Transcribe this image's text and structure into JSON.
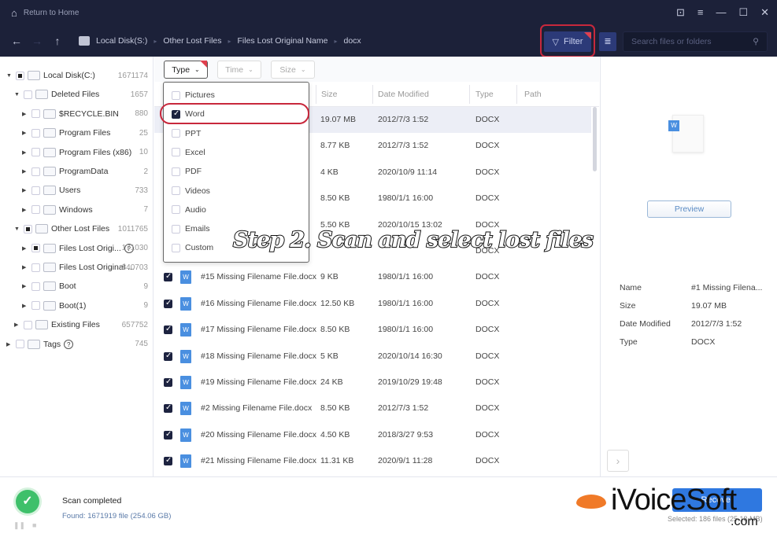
{
  "titlebar": {
    "home_label": "Return to Home"
  },
  "nav": {
    "breadcrumbs": [
      "Local Disk(S:)",
      "Other Lost Files",
      "Files Lost Original Name",
      "docx"
    ],
    "filter_label": "Filter",
    "search_placeholder": "Search files or folders"
  },
  "tree": [
    {
      "label": "Local Disk(C:)",
      "count": "1671174",
      "level": 0,
      "state": "part",
      "open": true
    },
    {
      "label": "Deleted Files",
      "count": "1657",
      "level": 1,
      "state": "none",
      "open": true
    },
    {
      "label": "$RECYCLE.BIN",
      "count": "880",
      "level": 2,
      "state": "none"
    },
    {
      "label": "Program Files",
      "count": "25",
      "level": 2,
      "state": "none"
    },
    {
      "label": "Program Files (x86)",
      "count": "10",
      "level": 2,
      "state": "none"
    },
    {
      "label": "ProgramData",
      "count": "2",
      "level": 2,
      "state": "none"
    },
    {
      "label": "Users",
      "count": "733",
      "level": 2,
      "state": "none"
    },
    {
      "label": "Windows",
      "count": "7",
      "level": 2,
      "state": "none"
    },
    {
      "label": "Other Lost Files",
      "count": "1011765",
      "level": 1,
      "state": "part",
      "open": true
    },
    {
      "label": "Files Lost Origi...",
      "count": "171030",
      "level": 2,
      "state": "part",
      "help": true
    },
    {
      "label": "Files Lost Original ...",
      "count": "840703",
      "level": 2,
      "state": "none"
    },
    {
      "label": "Boot",
      "count": "9",
      "level": 2,
      "state": "none"
    },
    {
      "label": "Boot(1)",
      "count": "9",
      "level": 2,
      "state": "none"
    },
    {
      "label": "Existing Files",
      "count": "657752",
      "level": 1,
      "state": "none"
    },
    {
      "label": "Tags",
      "count": "745",
      "level": 0,
      "state": "none",
      "help": true
    }
  ],
  "filters": {
    "type": "Type",
    "time": "Time",
    "size": "Size"
  },
  "type_options": [
    {
      "label": "Pictures",
      "checked": false
    },
    {
      "label": "Word",
      "checked": true
    },
    {
      "label": "PPT",
      "checked": false
    },
    {
      "label": "Excel",
      "checked": false
    },
    {
      "label": "PDF",
      "checked": false
    },
    {
      "label": "Videos",
      "checked": false
    },
    {
      "label": "Audio",
      "checked": false
    },
    {
      "label": "Emails",
      "checked": false
    },
    {
      "label": "Custom",
      "checked": false
    }
  ],
  "columns": {
    "size": "Size",
    "date": "Date Modified",
    "type": "Type",
    "path": "Path"
  },
  "files": [
    {
      "name": "",
      "size": "19.07 MB",
      "date": "2012/7/3 1:52",
      "type": "DOCX"
    },
    {
      "name": "",
      "size": "8.77 KB",
      "date": "2012/7/3 1:52",
      "type": "DOCX"
    },
    {
      "name": "",
      "size": "4 KB",
      "date": "2020/10/9 11:14",
      "type": "DOCX"
    },
    {
      "name": "",
      "size": "8.50 KB",
      "date": "1980/1/1 16:00",
      "type": "DOCX"
    },
    {
      "name": "",
      "size": "5.50 KB",
      "date": "2020/10/15 13:02",
      "type": "DOCX"
    },
    {
      "name": "",
      "size": "",
      "date": "",
      "type": "DOCX"
    },
    {
      "name": "#15 Missing Filename File.docx",
      "size": "9 KB",
      "date": "1980/1/1 16:00",
      "type": "DOCX"
    },
    {
      "name": "#16 Missing Filename File.docx",
      "size": "12.50 KB",
      "date": "1980/1/1 16:00",
      "type": "DOCX"
    },
    {
      "name": "#17 Missing Filename File.docx",
      "size": "8.50 KB",
      "date": "1980/1/1 16:00",
      "type": "DOCX"
    },
    {
      "name": "#18 Missing Filename File.docx",
      "size": "5 KB",
      "date": "2020/10/14 16:30",
      "type": "DOCX"
    },
    {
      "name": "#19 Missing Filename File.docx",
      "size": "24 KB",
      "date": "2019/10/29 19:48",
      "type": "DOCX"
    },
    {
      "name": "#2 Missing Filename File.docx",
      "size": "8.50 KB",
      "date": "2012/7/3 1:52",
      "type": "DOCX"
    },
    {
      "name": "#20 Missing Filename File.docx",
      "size": "4.50 KB",
      "date": "2018/3/27 9:53",
      "type": "DOCX"
    },
    {
      "name": "#21 Missing Filename File.docx",
      "size": "11.31 KB",
      "date": "2020/9/1 11:28",
      "type": "DOCX"
    }
  ],
  "overlay_caption": "Step 2. Scan and select lost files",
  "details": {
    "preview_label": "Preview",
    "labels": [
      "Name",
      "Size",
      "Date Modified",
      "Type"
    ],
    "values": [
      "#1 Missing Filena...",
      "19.07 MB",
      "2012/7/3 1:52",
      "DOCX"
    ]
  },
  "status": {
    "title": "Scan completed",
    "found": "Found: 1671919 file (254.06 GB)",
    "recover_label": "Recover",
    "selected": "Selected: 186 files (25.18 MB)"
  },
  "watermark": {
    "text": "iVoiceSoft",
    "suffix": ".com"
  },
  "colors": {
    "titlebar": "#1c2139",
    "accent": "#2f78e0",
    "highlight": "#c8283c",
    "success": "#3ec06a"
  }
}
